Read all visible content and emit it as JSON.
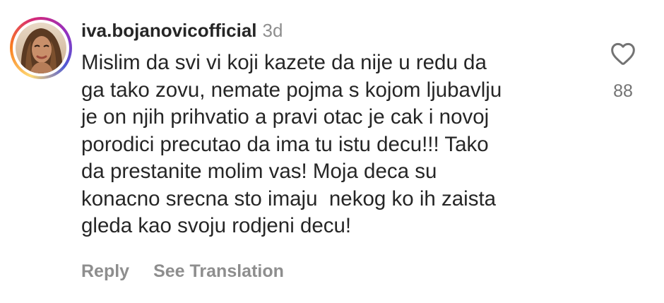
{
  "comment": {
    "username": "iva.bojanovicofficial",
    "timestamp": "3d",
    "avatar_icon": "profile-photo",
    "story_ring_colors": [
      "#feda75",
      "#fa7e1e",
      "#d62976",
      "#962fbf",
      "#4f5bd5"
    ],
    "text_lines": [
      "Mislim da svi vi koji kazete da nije u redu da",
      "ga tako zovu, nemate pojma s kojom ljubavlju",
      "je on njih prihvatio a pravi otac je cak i novoj",
      "porodici precutao da ima tu istu decu!!! Tako",
      "da prestanite molim vas! Moja deca su",
      "konacno srecna sto imaju  nekog ko ih zaista",
      "gleda kao svoju rodjeni decu!"
    ],
    "like_icon": "heart-outline-icon",
    "like_count": "88",
    "actions": {
      "reply_label": "Reply",
      "translate_label": "See Translation"
    }
  }
}
